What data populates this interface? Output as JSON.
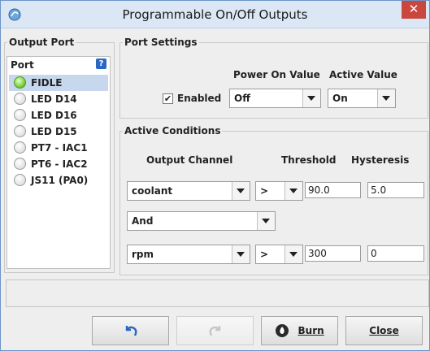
{
  "window": {
    "title": "Programmable On/Off Outputs",
    "close_glyph": "✕"
  },
  "output_port": {
    "group_label": "Output Port",
    "header_label": "Port",
    "help_glyph": "?",
    "items": [
      {
        "label": "FIDLE",
        "active": true,
        "selected": true
      },
      {
        "label": "LED D14",
        "active": false,
        "selected": false
      },
      {
        "label": "LED D16",
        "active": false,
        "selected": false
      },
      {
        "label": "LED D15",
        "active": false,
        "selected": false
      },
      {
        "label": "PT7 - IAC1",
        "active": false,
        "selected": false
      },
      {
        "label": "PT6 - IAC2",
        "active": false,
        "selected": false
      },
      {
        "label": "JS11 (PA0)",
        "active": false,
        "selected": false
      }
    ]
  },
  "port_settings": {
    "group_label": "Port Settings",
    "power_on_label": "Power On Value",
    "active_value_label": "Active Value",
    "enabled_label": "Enabled",
    "enabled_check": "✔",
    "power_on_value": "Off",
    "active_value": "On"
  },
  "active_conditions": {
    "group_label": "Active Conditions",
    "col_output_channel": "Output Channel",
    "col_threshold": "Threshold",
    "col_hysteresis": "Hysteresis",
    "row1": {
      "channel": "coolant",
      "operator": ">",
      "threshold": "90.0",
      "hysteresis": "5.0"
    },
    "logic": "And",
    "row2": {
      "channel": "rpm",
      "operator": ">",
      "threshold": "300",
      "hysteresis": "0"
    }
  },
  "status_text": "",
  "buttons": {
    "burn": "Burn",
    "close": "Close"
  },
  "colors": {
    "accent": "#2a66c3",
    "led_on": "#79d13a",
    "selected_row": "#c6d7ee",
    "close_red": "#c9473c"
  }
}
